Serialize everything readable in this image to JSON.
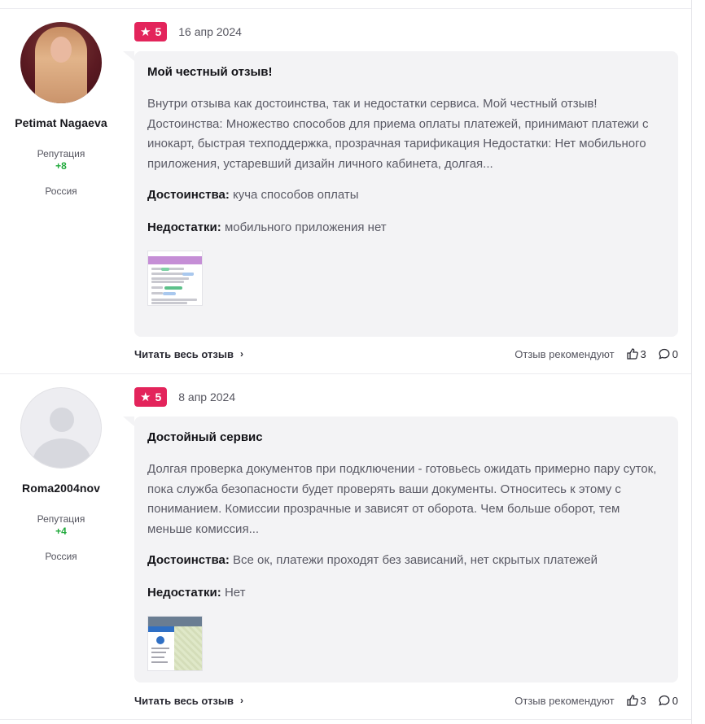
{
  "reviews": [
    {
      "author": {
        "name": "Petimat Nagaeva",
        "reputation_label": "Репутация",
        "reputation": "+8",
        "country": "Россия"
      },
      "rating": "5",
      "date": "16 апр 2024",
      "title": "Мой честный отзыв!",
      "text": "Внутри отзыва как достоинства, так и недостатки сервиса. Мой честный отзыв! Достоинства: Множество способов для приема оплаты платежей, принимают платежи с инокарт, быстрая техподдержка, прозрачная тарификация Недостатки: Нет мобильного приложения, устаревший дизайн личного кабинета, долгая...",
      "pros_label": "Достоинства:",
      "pros": "куча способов оплаты",
      "cons_label": "Недостатки:",
      "cons": "мобильного приложения нет",
      "read_more": "Читать весь отзыв",
      "recommend": "Отзыв рекомендуют",
      "likes": "3",
      "comments": "0"
    },
    {
      "author": {
        "name": "Roma2004nov",
        "reputation_label": "Репутация",
        "reputation": "+4",
        "country": "Россия"
      },
      "rating": "5",
      "date": "8 апр 2024",
      "title": "Достойный сервис",
      "text": "Долгая проверка документов при подключении - готовьесь ожидать примерно пару суток, пока служба безопасности будет проверять ваши документы. Относитесь к этому с пониманием. Комиссии прозрачные и зависят от оборота. Чем больше оборот, тем меньше комиссия...",
      "pros_label": "Достоинства:",
      "pros": "Все ок, платежи проходят без зависаний, нет скрытых платежей",
      "cons_label": "Недостатки:",
      "cons": "Нет",
      "read_more": "Читать весь отзыв",
      "recommend": "Отзыв рекомендуют",
      "likes": "3",
      "comments": "0"
    }
  ],
  "icons": {
    "star": "star-icon",
    "chevron": "chevron-right-icon",
    "like": "thumbs-up-icon",
    "comment": "comment-icon"
  },
  "colors": {
    "rating_badge": "#e3245b",
    "reputation": "#1fa93a",
    "bubble": "#f3f3f5"
  }
}
